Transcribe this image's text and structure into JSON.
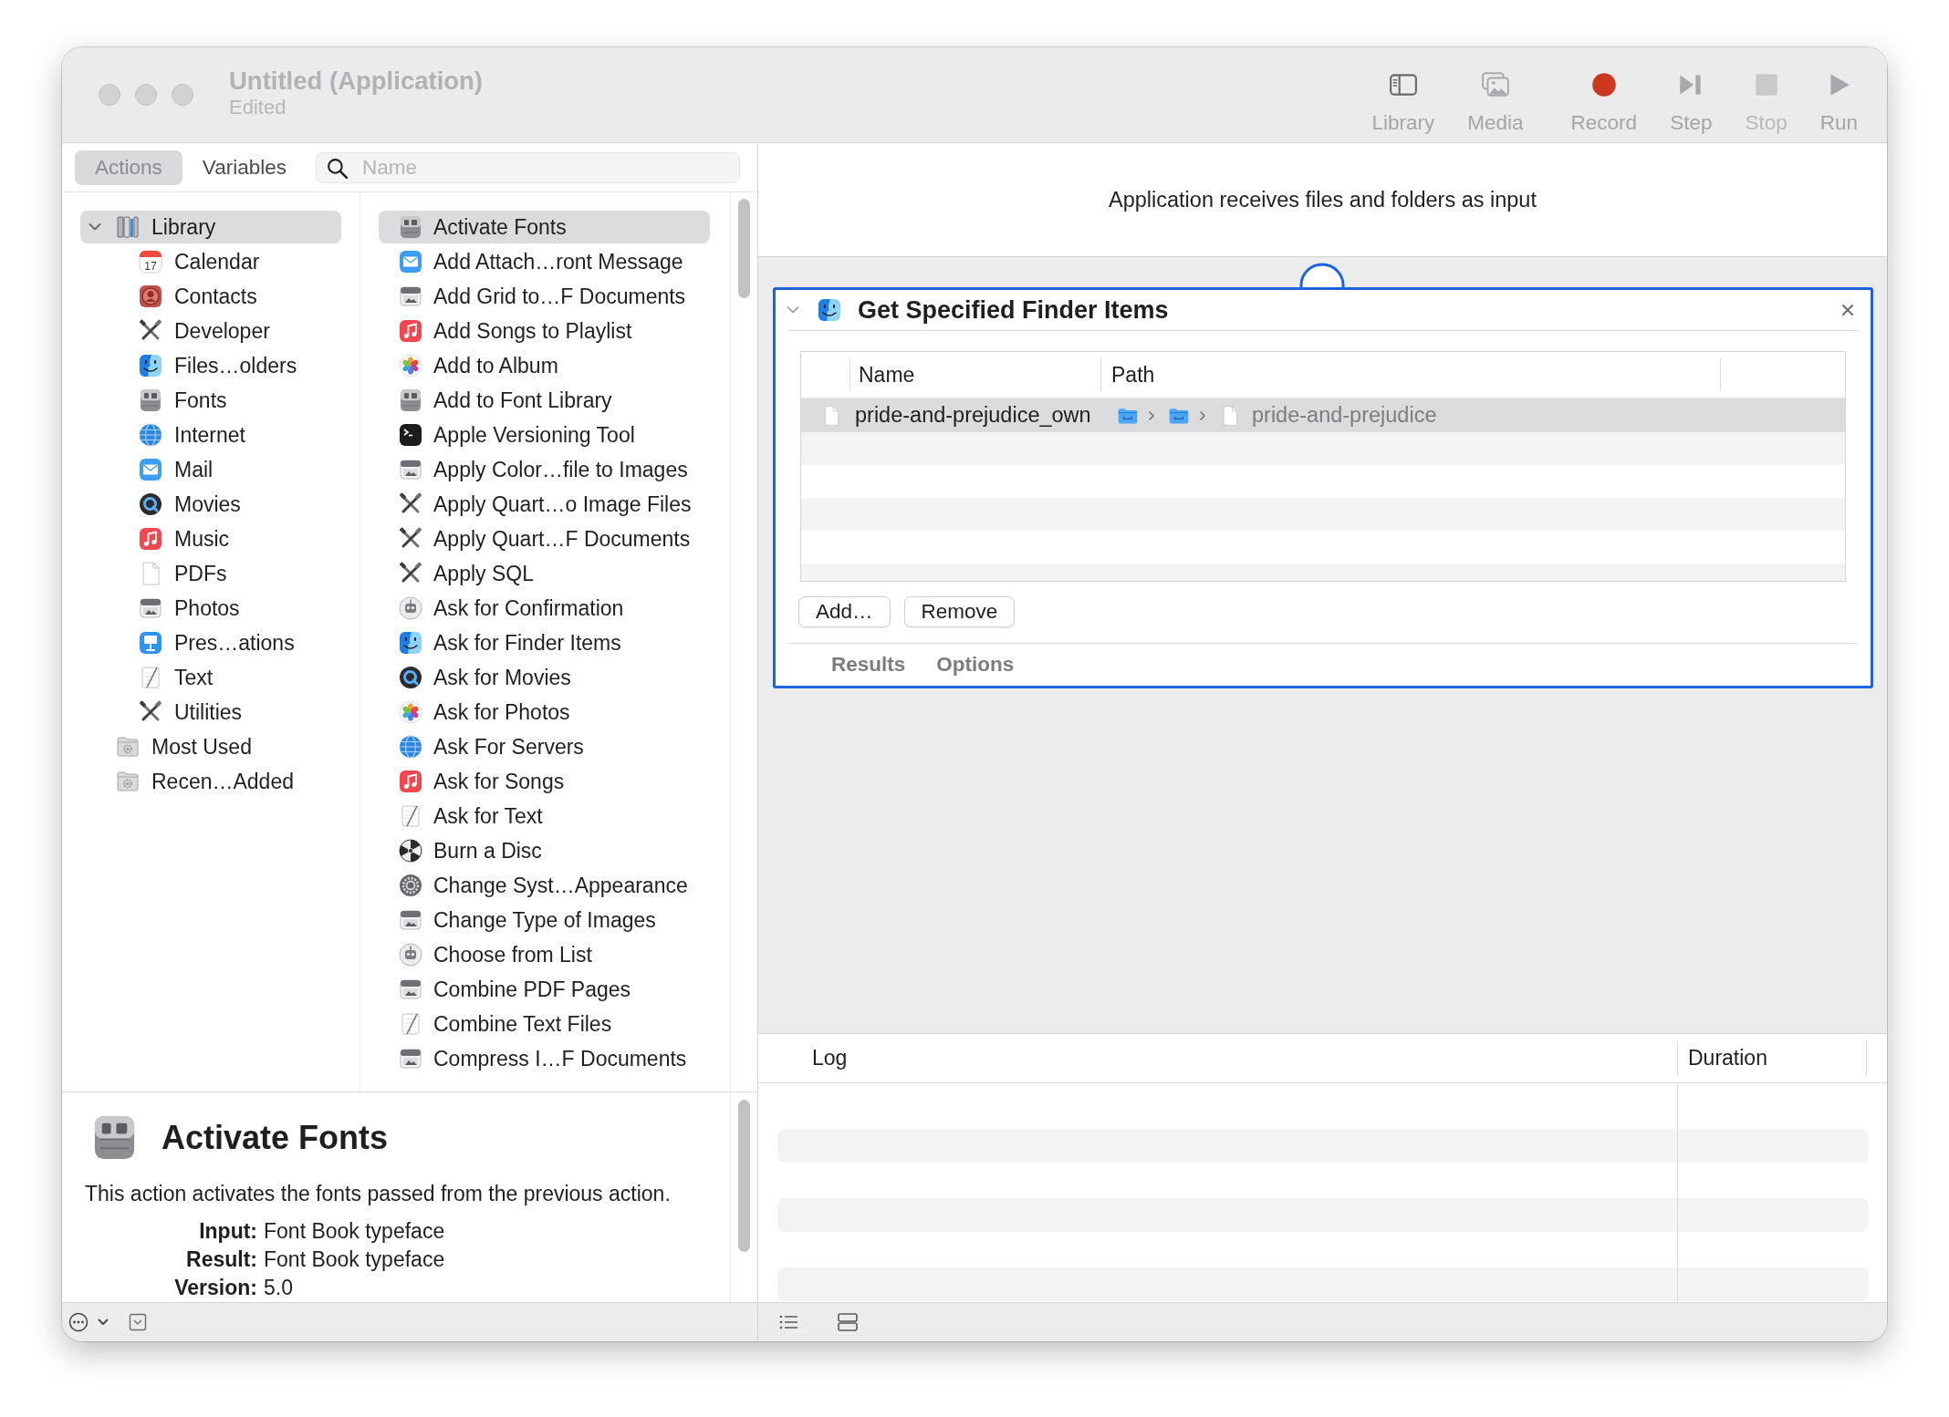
{
  "window": {
    "title": "Untitled (Application)",
    "subtitle": "Edited",
    "focused": false
  },
  "toolbar": [
    {
      "kind": "library",
      "label": "Library",
      "disabled": false
    },
    {
      "kind": "media",
      "label": "Media",
      "disabled": false
    },
    {
      "kind": "record",
      "label": "Record",
      "disabled": false
    },
    {
      "kind": "step",
      "label": "Step",
      "disabled": false
    },
    {
      "kind": "stop",
      "label": "Stop",
      "disabled": true
    },
    {
      "kind": "run",
      "label": "Run",
      "disabled": false
    }
  ],
  "sidebar": {
    "tabs": [
      {
        "label": "Actions",
        "selected": true
      },
      {
        "label": "Variables",
        "selected": false
      }
    ],
    "search": {
      "placeholder": "Name"
    },
    "library": [
      {
        "kind": "library",
        "label": "Library",
        "expanded": true,
        "selected": true,
        "children": [
          {
            "kind": "calendar",
            "label": "Calendar",
            "date": "17",
            "selected": false
          },
          {
            "kind": "contacts",
            "label": "Contacts",
            "selected": false
          },
          {
            "kind": "tools",
            "label": "Developer",
            "selected": false
          },
          {
            "kind": "finder",
            "label": "Files…olders",
            "selected": false
          },
          {
            "kind": "fonts",
            "label": "Fonts",
            "selected": false
          },
          {
            "kind": "globe",
            "label": "Internet",
            "selected": false
          },
          {
            "kind": "mail",
            "label": "Mail",
            "selected": false
          },
          {
            "kind": "quicktime",
            "label": "Movies",
            "selected": false
          },
          {
            "kind": "music",
            "label": "Music",
            "selected": false
          },
          {
            "kind": "document",
            "label": "PDFs",
            "selected": false
          },
          {
            "kind": "preview",
            "label": "Photos",
            "selected": false
          },
          {
            "kind": "keynote",
            "label": "Pres…ations",
            "selected": false
          },
          {
            "kind": "textedit",
            "label": "Text",
            "selected": false
          },
          {
            "kind": "tools",
            "label": "Utilities",
            "selected": false
          }
        ]
      },
      {
        "kind": "smart-folder",
        "label": "Most Used",
        "selected": false
      },
      {
        "kind": "smart-folder",
        "label": "Recen…Added",
        "selected": false
      }
    ],
    "actions": [
      {
        "kind": "fonts",
        "label": "Activate Fonts",
        "selected": true
      },
      {
        "kind": "mail",
        "label": "Add Attach…ront Message",
        "selected": false
      },
      {
        "kind": "preview",
        "label": "Add Grid to…F Documents",
        "selected": false
      },
      {
        "kind": "music",
        "label": "Add Songs to Playlist",
        "selected": false
      },
      {
        "kind": "photos",
        "label": "Add to Album",
        "selected": false
      },
      {
        "kind": "fonts",
        "label": "Add to Font Library",
        "selected": false
      },
      {
        "kind": "terminal",
        "label": "Apple Versioning Tool",
        "selected": false
      },
      {
        "kind": "preview",
        "label": "Apply Color…file to Images",
        "selected": false
      },
      {
        "kind": "tools",
        "label": "Apply Quart…o Image Files",
        "selected": false
      },
      {
        "kind": "tools",
        "label": "Apply Quart…F Documents",
        "selected": false
      },
      {
        "kind": "tools",
        "label": "Apply SQL",
        "selected": false
      },
      {
        "kind": "automator",
        "label": "Ask for Confirmation",
        "selected": false
      },
      {
        "kind": "finder",
        "label": "Ask for Finder Items",
        "selected": false
      },
      {
        "kind": "quicktime",
        "label": "Ask for Movies",
        "selected": false
      },
      {
        "kind": "photos",
        "label": "Ask for Photos",
        "selected": false
      },
      {
        "kind": "globe",
        "label": "Ask For Servers",
        "selected": false
      },
      {
        "kind": "music",
        "label": "Ask for Songs",
        "selected": false
      },
      {
        "kind": "textedit",
        "label": "Ask for Text",
        "selected": false
      },
      {
        "kind": "disc",
        "label": "Burn a Disc",
        "selected": false
      },
      {
        "kind": "settings",
        "label": "Change Syst…Appearance",
        "selected": false
      },
      {
        "kind": "preview",
        "label": "Change Type of Images",
        "selected": false
      },
      {
        "kind": "automator",
        "label": "Choose from List",
        "selected": false
      },
      {
        "kind": "preview",
        "label": "Combine PDF Pages",
        "selected": false
      },
      {
        "kind": "textedit",
        "label": "Combine Text Files",
        "selected": false
      },
      {
        "kind": "preview",
        "label": "Compress I…F Documents",
        "selected": false
      }
    ]
  },
  "description": {
    "kind": "fonts",
    "title": "Activate Fonts",
    "text": "This action activates the fonts passed from the previous action.",
    "fields": [
      {
        "label": "Input:",
        "value": "Font Book typeface"
      },
      {
        "label": "Result:",
        "value": "Font Book typeface"
      },
      {
        "label": "Version:",
        "value": "5.0"
      }
    ]
  },
  "workflow": {
    "input_note": "Application receives files and folders as input",
    "actions": [
      {
        "kind": "finder",
        "title": "Get Specified Finder Items",
        "expanded": true,
        "selected": true,
        "table": {
          "columns": [
            "Name",
            "Path"
          ],
          "rows": [
            {
              "name": "pride-and-prejudice_own",
              "path": [
                {
                  "kind": "folder"
                },
                {
                  "kind": "folder"
                },
                {
                  "kind": "document",
                  "label": "pride-and-prejudice"
                }
              ],
              "selected": true
            }
          ]
        },
        "buttons": [
          "Add…",
          "Remove"
        ],
        "views": [
          "Results",
          "Options"
        ]
      }
    ]
  },
  "log": {
    "columns": [
      "Log",
      "Duration"
    ]
  }
}
